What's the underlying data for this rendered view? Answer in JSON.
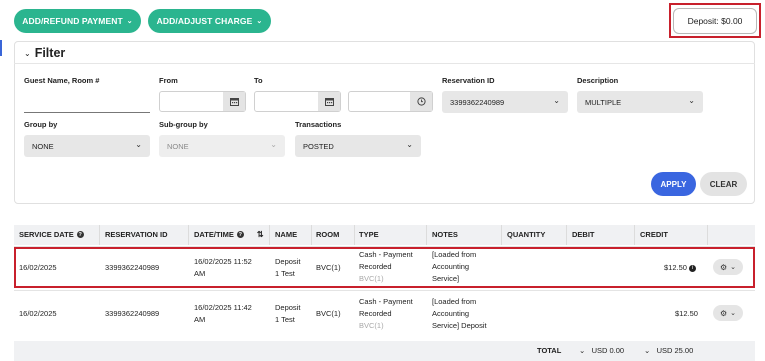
{
  "toolbar": {
    "add_refund_label": "ADD/REFUND PAYMENT",
    "add_adjust_label": "ADD/ADJUST CHARGE",
    "deposit_label": "Deposit: $0.00"
  },
  "filter": {
    "title": "Filter",
    "guest_label": "Guest Name, Room #",
    "guest_value": "",
    "from_label": "From",
    "to_label": "To",
    "reservation_label": "Reservation ID",
    "reservation_value": "3399362240989",
    "description_label": "Description",
    "description_value": "MULTIPLE",
    "group_by_label": "Group by",
    "group_by_value": "NONE",
    "subgroup_label": "Sub-group by",
    "subgroup_value": "NONE",
    "transactions_label": "Transactions",
    "transactions_value": "POSTED",
    "apply_label": "APPLY",
    "clear_label": "CLEAR"
  },
  "table": {
    "headers": {
      "service_date": "SERVICE DATE",
      "reservation_id": "RESERVATION ID",
      "datetime": "DATE/TIME",
      "name": "NAME",
      "room": "ROOM",
      "type": "TYPE",
      "notes": "NOTES",
      "quantity": "QUANTITY",
      "debit": "DEBIT",
      "credit": "CREDIT"
    },
    "rows": [
      {
        "service_date": "16/02/2025",
        "reservation_id": "3399362240989",
        "datetime_1": "16/02/2025 11:52",
        "datetime_2": "AM",
        "name_1": "Deposit",
        "name_2": "1 Test",
        "room": "BVC(1)",
        "type_1": "Cash - Payment",
        "type_2": "Recorded",
        "type_sub": "BVC(1)",
        "notes_1": "[Loaded from",
        "notes_2": "Accounting",
        "notes_3": "Service]",
        "credit": "$12.50"
      },
      {
        "service_date": "16/02/2025",
        "reservation_id": "3399362240989",
        "datetime_1": "16/02/2025 11:42",
        "datetime_2": "AM",
        "name_1": "Deposit",
        "name_2": "1 Test",
        "room": "BVC(1)",
        "type_1": "Cash - Payment",
        "type_2": "Recorded",
        "type_sub": "BVC(1)",
        "notes_1": "[Loaded from",
        "notes_2": "Accounting",
        "notes_3": "Service] Deposit",
        "credit": "$12.50"
      }
    ],
    "footer": {
      "total_label": "TOTAL",
      "debit_total": "USD 0.00",
      "credit_total": "USD 25.00"
    }
  },
  "colors": {
    "accent_green": "#2bb58f",
    "accent_blue": "#3a66e0",
    "highlight_red": "#c8202c"
  }
}
